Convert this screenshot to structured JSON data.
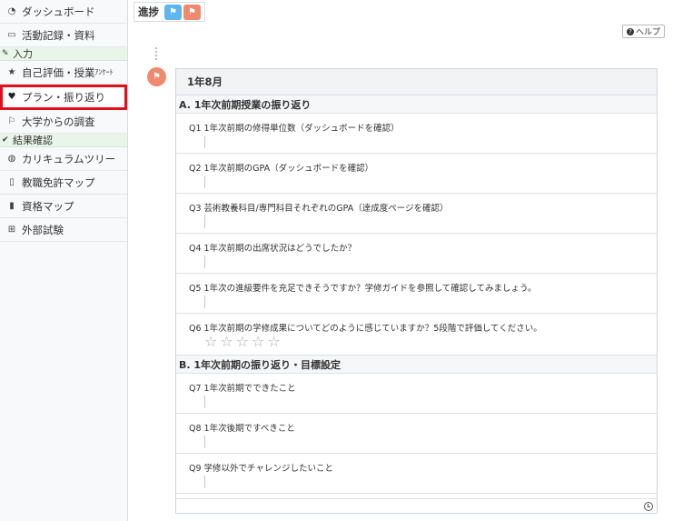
{
  "sidebar": {
    "items": [
      {
        "label": "ダッシュボード",
        "icon": "dashboard-icon"
      },
      {
        "label": "活動記録・資料",
        "icon": "id-card-icon"
      },
      {
        "section": "入力",
        "icon": "pencil-icon"
      },
      {
        "label": "自己評価・授業",
        "label_small": "ｱﾝｹｰﾄ",
        "icon": "star-icon"
      },
      {
        "label": "プラン・振り返り",
        "icon": "heart-icon",
        "active": true
      },
      {
        "label": "大学からの調査",
        "icon": "flag-outline-icon"
      },
      {
        "section": "結果確認",
        "icon": "check-icon"
      },
      {
        "label": "カリキュラムツリー",
        "icon": "globe-icon"
      },
      {
        "label": "教職免許マップ",
        "icon": "map-outline-icon"
      },
      {
        "label": "資格マップ",
        "icon": "map-icon"
      },
      {
        "label": "外部試験",
        "icon": "sitemap-icon"
      }
    ]
  },
  "progress": {
    "label": "進捗"
  },
  "help": {
    "label": "ヘルプ"
  },
  "card": {
    "title": "1年8月",
    "sections": [
      {
        "title": "A. 1年次前期授業の振り返り",
        "questions": [
          "Q1 1年次前期の修得単位数（ダッシュボードを確認）",
          "Q2 1年次前期のGPA（ダッシュボードを確認）",
          "Q3 芸術教養科目/専門科目それぞれのGPA（達成度ページを確認）",
          "Q4 1年次前期の出席状況はどうでしたか？",
          "Q5 1年次の進級要件を充足できそうですか？学修ガイドを参照して確認してみましょう。",
          "Q6 1年次前期の学修成果についてどのように感じていますか？5段階で評価してください。"
        ],
        "rating_max": 5
      },
      {
        "title": "B. 1年次前期の振り返り・目標設定",
        "questions": [
          "Q7 1年次前期でできたこと",
          "Q8 1年次後期ですべきこと",
          "Q9 学修以外でチャレンジしたいこと"
        ]
      }
    ]
  },
  "colors": {
    "accent_orange": "#f08a6e",
    "accent_blue": "#5fb6ee",
    "active_border": "#e0101c"
  }
}
